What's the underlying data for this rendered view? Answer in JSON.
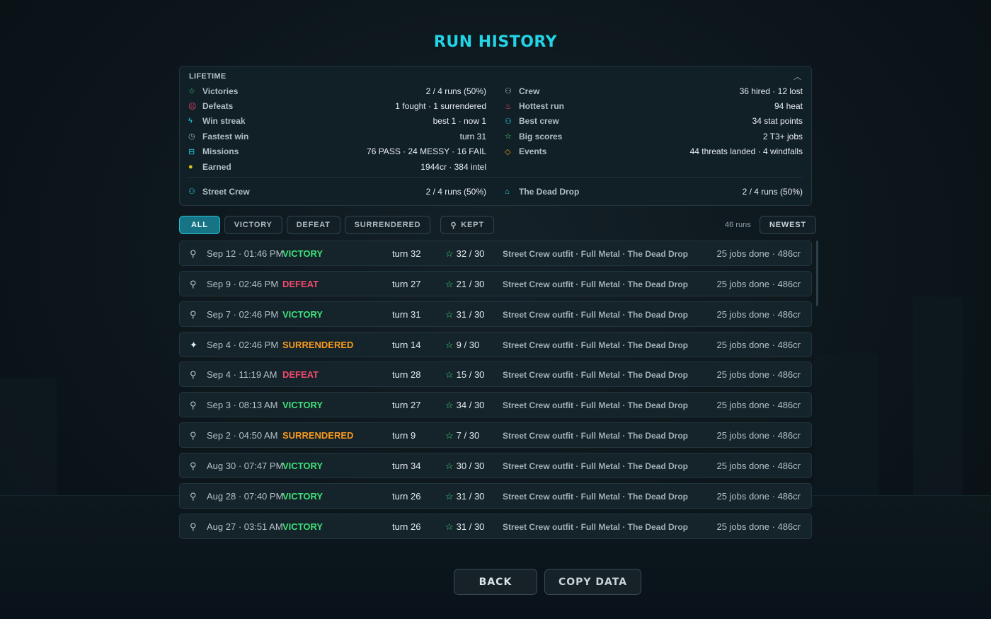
{
  "title": "RUN HISTORY",
  "lifetime": {
    "title": "LIFETIME",
    "collapse_icon": "chevron-up-icon",
    "left": [
      {
        "icon": "star-icon",
        "icon_char": "☆",
        "icon_color": "#3ee07a",
        "label": "Victories",
        "value": "2 / 4 runs (50%)"
      },
      {
        "icon": "frown-icon",
        "icon_char": "☹",
        "icon_color": "#f24a6e",
        "label": "Defeats",
        "value": "1 fought · 1 surrendered"
      },
      {
        "icon": "bolt-icon",
        "icon_char": "ϟ",
        "icon_color": "#22d4e6",
        "label": "Win streak",
        "value": "best 1 · now 1"
      },
      {
        "icon": "clock-icon",
        "icon_char": "◷",
        "icon_color": "#9fb1b8",
        "label": "Fastest win",
        "value": "turn 31"
      },
      {
        "icon": "briefcase-icon",
        "icon_char": "⊟",
        "icon_color": "#22d4e6",
        "label": "Missions",
        "value": "76 PASS · 24 MESSY · 16 FAIL"
      },
      {
        "icon": "coin-icon",
        "icon_char": "●",
        "icon_color": "#e3c21e",
        "label": "Earned",
        "value": "1944cr · 384 intel"
      }
    ],
    "right": [
      {
        "icon": "users-icon",
        "icon_char": "⚇",
        "icon_color": "#b7c5cb",
        "label": "Crew",
        "value": "36 hired · 12 lost"
      },
      {
        "icon": "flame-icon",
        "icon_char": "♨",
        "icon_color": "#f24a6e",
        "label": "Hottest run",
        "value": "94 heat"
      },
      {
        "icon": "users-icon",
        "icon_char": "⚇",
        "icon_color": "#22d4e6",
        "label": "Best crew",
        "value": "34 stat points"
      },
      {
        "icon": "star-icon",
        "icon_char": "☆",
        "icon_color": "#3ee07a",
        "label": "Big scores",
        "value": "2 T3+ jobs"
      },
      {
        "icon": "diamond-icon",
        "icon_char": "◇",
        "icon_color": "#f79a1f",
        "label": "Events",
        "value": "44 threats landed · 4 windfalls"
      }
    ],
    "footer_left": {
      "icon": "users-icon",
      "icon_char": "⚇",
      "icon_color": "#22d4e6",
      "label": "Street Crew",
      "value": "2 / 4 runs (50%)"
    },
    "footer_right": {
      "icon": "store-icon",
      "icon_char": "⌂",
      "icon_color": "#22d4e6",
      "label": "The Dead Drop",
      "value": "2 / 4 runs (50%)"
    }
  },
  "filters": {
    "all": "ALL",
    "victory": "VICTORY",
    "defeat": "DEFEAT",
    "surrendered": "SURRENDERED",
    "kept": "KEPT",
    "runs_count": "46 runs",
    "sort": "NEWEST"
  },
  "runs": [
    {
      "pinned": false,
      "date": "Sep 12 · 01:46 PM",
      "outcome": "VICTORY",
      "turn": "turn 32",
      "score": "32 / 30",
      "outfit": "Street Crew outfit · Full Metal · The Dead Drop",
      "jobs": "25 jobs done · 486cr"
    },
    {
      "pinned": false,
      "date": "Sep 9 · 02:46 PM",
      "outcome": "DEFEAT",
      "turn": "turn 27",
      "score": "21 / 30",
      "outfit": "Street Crew outfit · Full Metal · The Dead Drop",
      "jobs": "25 jobs done · 486cr"
    },
    {
      "pinned": false,
      "date": "Sep 7 · 02:46 PM",
      "outcome": "VICTORY",
      "turn": "turn 31",
      "score": "31 / 30",
      "outfit": "Street Crew outfit · Full Metal · The Dead Drop",
      "jobs": "25 jobs done · 486cr"
    },
    {
      "pinned": true,
      "date": "Sep 4 · 02:46 PM",
      "outcome": "SURRENDERED",
      "turn": "turn 14",
      "score": "9 / 30",
      "outfit": "Street Crew outfit · Full Metal · The Dead Drop",
      "jobs": "25 jobs done · 486cr"
    },
    {
      "pinned": false,
      "date": "Sep 4 · 11:19 AM",
      "outcome": "DEFEAT",
      "turn": "turn 28",
      "score": "15 / 30",
      "outfit": "Street Crew outfit · Full Metal · The Dead Drop",
      "jobs": "25 jobs done · 486cr"
    },
    {
      "pinned": false,
      "date": "Sep 3 · 08:13 AM",
      "outcome": "VICTORY",
      "turn": "turn 27",
      "score": "34 / 30",
      "outfit": "Street Crew outfit · Full Metal · The Dead Drop",
      "jobs": "25 jobs done · 486cr"
    },
    {
      "pinned": false,
      "date": "Sep 2 · 04:50 AM",
      "outcome": "SURRENDERED",
      "turn": "turn 9",
      "score": "7 / 30",
      "outfit": "Street Crew outfit · Full Metal · The Dead Drop",
      "jobs": "25 jobs done · 486cr"
    },
    {
      "pinned": false,
      "date": "Aug 30 · 07:47 PM",
      "outcome": "VICTORY",
      "turn": "turn 34",
      "score": "30 / 30",
      "outfit": "Street Crew outfit · Full Metal · The Dead Drop",
      "jobs": "25 jobs done · 486cr"
    },
    {
      "pinned": false,
      "date": "Aug 28 · 07:40 PM",
      "outcome": "VICTORY",
      "turn": "turn 26",
      "score": "31 / 30",
      "outfit": "Street Crew outfit · Full Metal · The Dead Drop",
      "jobs": "25 jobs done · 486cr"
    },
    {
      "pinned": false,
      "date": "Aug 27 · 03:51 AM",
      "outcome": "VICTORY",
      "turn": "turn 26",
      "score": "31 / 30",
      "outfit": "Street Crew outfit · Full Metal · The Dead Drop",
      "jobs": "25 jobs done · 486cr"
    }
  ],
  "buttons": {
    "back": "BACK",
    "copy": "COPY DATA"
  },
  "colors": {
    "accent": "#22d4e6",
    "victory": "#3ee07a",
    "defeat": "#f24a6e",
    "surrendered": "#f79a1f"
  }
}
